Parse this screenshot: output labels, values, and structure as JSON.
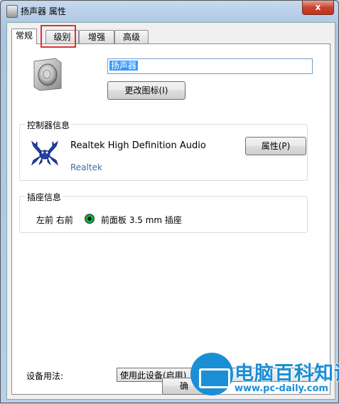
{
  "window": {
    "title": "扬声器 属性",
    "close": "x"
  },
  "tabs": [
    {
      "label": "常规",
      "active": true
    },
    {
      "label": "级别",
      "active": false
    },
    {
      "label": "增强",
      "active": false
    },
    {
      "label": "高级",
      "active": false
    }
  ],
  "general": {
    "device_name": "扬声器",
    "change_icon_button": "更改图标(I)",
    "controller": {
      "title": "控制器信息",
      "name": "Realtek High Definition Audio",
      "vendor": "Realtek",
      "properties_button": "属性(P)"
    },
    "jack": {
      "title": "插座信息",
      "channels": "左前 右前",
      "description": "前面板 3.5 mm 插座"
    },
    "device_usage_label": "设备用法:",
    "device_usage_value": "使用此设备(启用)",
    "ok_button_partial": "确"
  },
  "watermark": {
    "title": "电脑百科知识",
    "url": "www.pc-daily.com"
  },
  "colors": {
    "highlight": "#e03131",
    "link": "#3a6ea5",
    "jack": "#1db31d",
    "brand": "#1a8fd6"
  }
}
